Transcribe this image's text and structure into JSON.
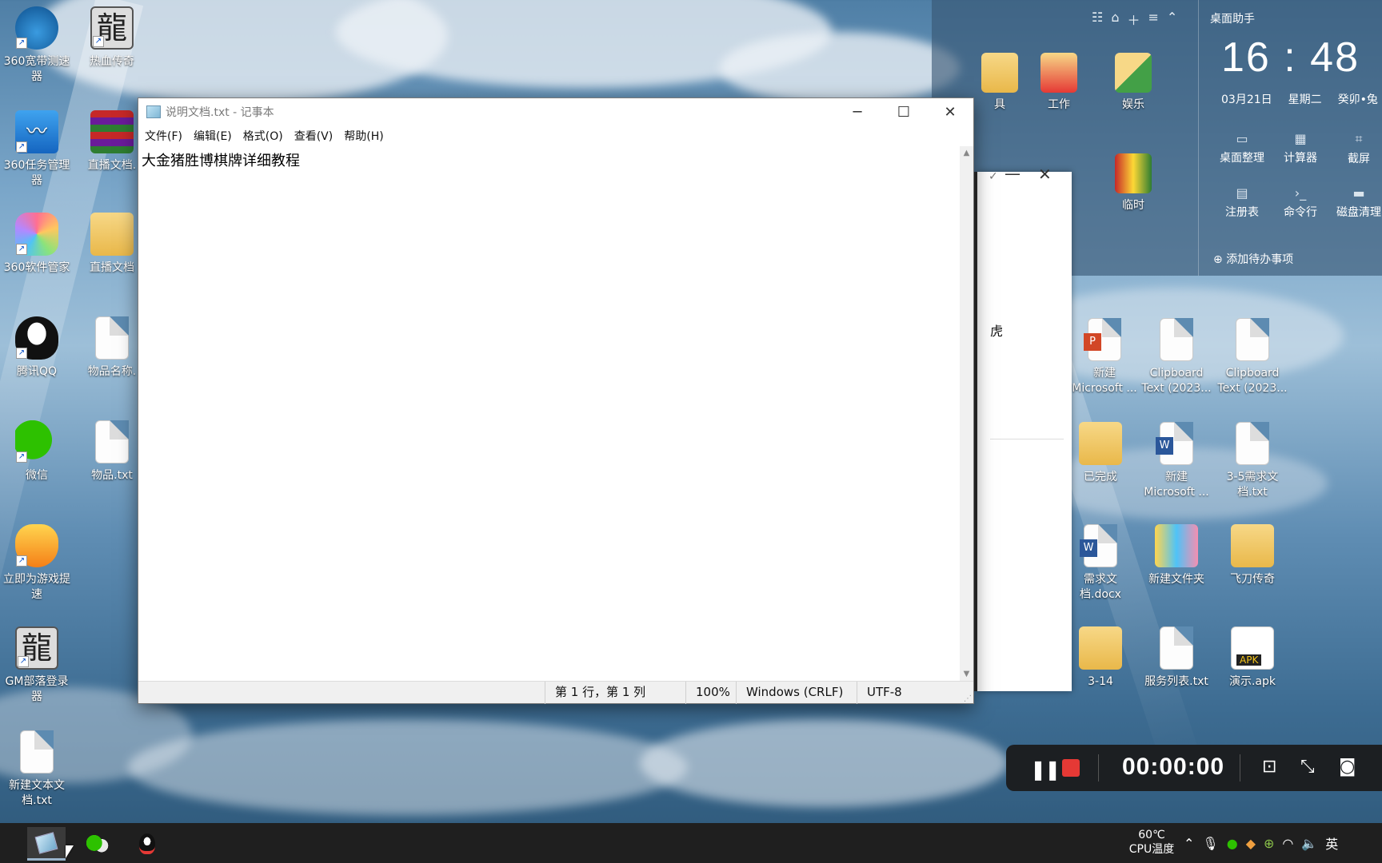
{
  "desktop_icons_left": [
    {
      "label": "360宽带测速器",
      "icon": "speedometer-icon"
    },
    {
      "label": "热血传奇",
      "icon": "dragon-logo-icon"
    },
    {
      "label": "360任务管理器",
      "icon": "task-monitor-icon"
    },
    {
      "label": "直播文档.",
      "icon": "archive-icon"
    },
    {
      "label": "360软件管家",
      "icon": "software-manager-icon"
    },
    {
      "label": "直播文档",
      "icon": "folder-icon"
    },
    {
      "label": "腾讯QQ",
      "icon": "qq-penguin-icon"
    },
    {
      "label": "物品名称.",
      "icon": "text-file-icon"
    },
    {
      "label": "微信",
      "icon": "wechat-icon"
    },
    {
      "label": "物品.txt",
      "icon": "text-file-icon"
    },
    {
      "label": "立即为游戏提速",
      "icon": "game-boost-icon"
    },
    {
      "label": "GM部落登录器",
      "icon": "dragon-logo-icon"
    },
    {
      "label": "新建文本文档.txt",
      "icon": "text-file-icon"
    }
  ],
  "desktop_icons_right": [
    {
      "label": "具",
      "icon": "folder-icon"
    },
    {
      "label": "工作",
      "icon": "folder-icon"
    },
    {
      "label": "娱乐",
      "icon": "folder-icon"
    },
    {
      "label": "临时",
      "icon": "folder-icon"
    },
    {
      "label": "新建 Microsoft ...",
      "icon": "powerpoint-file-icon"
    },
    {
      "label": "Clipboard Text (2023...",
      "icon": "text-file-icon"
    },
    {
      "label": "Clipboard Text (2023...",
      "icon": "text-file-icon"
    },
    {
      "label": "已完成",
      "icon": "folder-icon"
    },
    {
      "label": "新建 Microsoft ...",
      "icon": "word-file-icon"
    },
    {
      "label": "3-5需求文档.txt",
      "icon": "text-file-icon"
    },
    {
      "label": "需求文档.docx",
      "icon": "word-file-icon"
    },
    {
      "label": "新建文件夹",
      "icon": "folder-icon"
    },
    {
      "label": "飞刀传奇",
      "icon": "folder-icon"
    },
    {
      "label": "3-14",
      "icon": "folder-icon"
    },
    {
      "label": "服务列表.txt",
      "icon": "text-file-icon"
    },
    {
      "label": "演示.apk",
      "icon": "apk-file-icon"
    }
  ],
  "widget": {
    "title": "桌面助手",
    "time": "16 : 48",
    "date": "03月21日",
    "weekday": "星期二",
    "lunar": "癸卯•兔",
    "tools": [
      "桌面整理",
      "计算器",
      "截屏",
      "注册表",
      "命令行",
      "磁盘清理"
    ],
    "todo": "添加待办事项"
  },
  "background_window": {
    "partial_text": "虎"
  },
  "notepad": {
    "title": "说明文档.txt - 记事本",
    "menu": [
      "文件(F)",
      "编辑(E)",
      "格式(O)",
      "查看(V)",
      "帮助(H)"
    ],
    "content": "大金猪胜博棋牌详细教程",
    "status": {
      "position": "第 1 行，第 1 列",
      "zoom": "100%",
      "line_ending": "Windows (CRLF)",
      "encoding": "UTF-8"
    }
  },
  "recorder": {
    "timer": "00:00:00"
  },
  "taskbar": {
    "cpu_temp": "60℃",
    "cpu_label": "CPU温度",
    "ime": "英"
  }
}
